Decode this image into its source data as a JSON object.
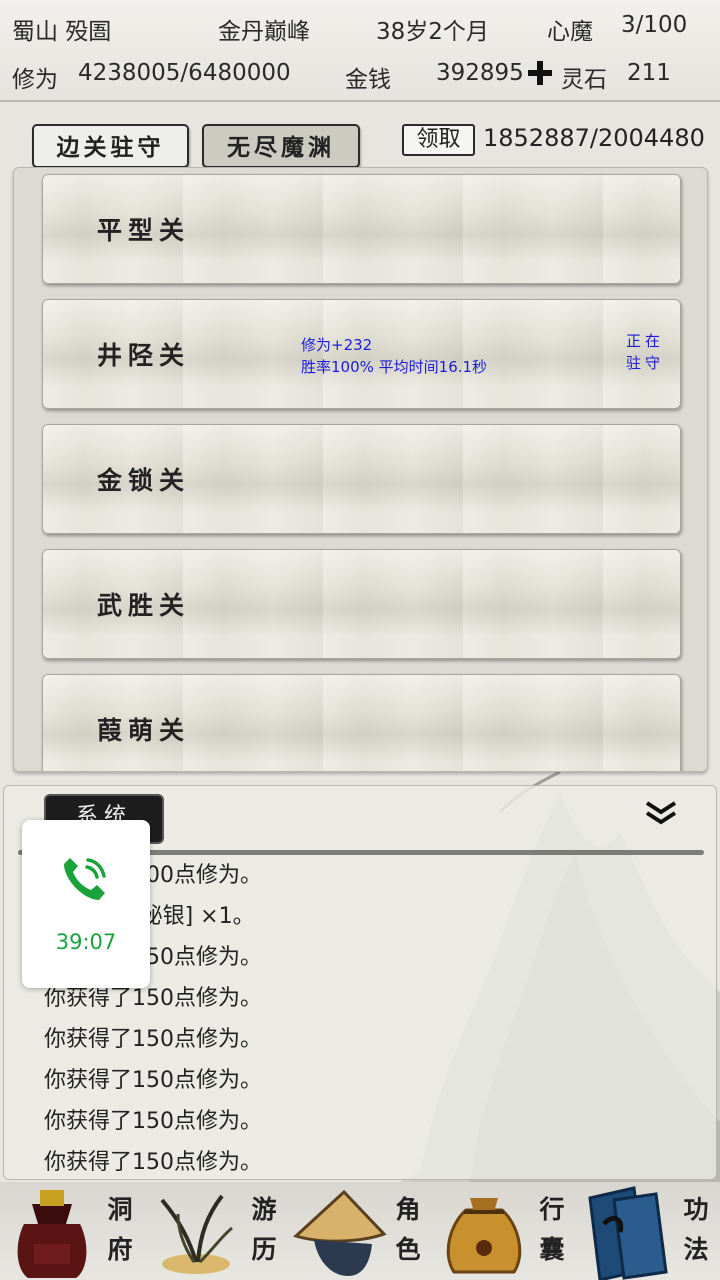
{
  "status": {
    "location": "蜀山 殁圄",
    "realm": "金丹巅峰",
    "age": "38岁2个月",
    "demon_label": "心魔",
    "demon_value": "3/100",
    "cultivation_label": "修为",
    "cultivation_value": "4238005/6480000",
    "money_label": "金钱",
    "money_value": "392895",
    "spirit_label": "灵石",
    "spirit_value": "211"
  },
  "tabs": [
    {
      "label": "边关驻守"
    },
    {
      "label": "无尽魔渊"
    }
  ],
  "claim": {
    "button_label": "领取",
    "progress": "1852887/2004480"
  },
  "passes": [
    {
      "name": "平型关"
    },
    {
      "name": "井陉关",
      "stat1": "修为+232",
      "stat2": "胜率100% 平均时间16.1秒",
      "status": "正在驻守"
    },
    {
      "name": "金锁关"
    },
    {
      "name": "武胜关"
    },
    {
      "name": "葭萌关"
    }
  ],
  "log": {
    "tab_label": "系统",
    "lines": [
      "你获得了300点修为。",
      "你获得了[秘银] ×1。",
      "你获得了150点修为。",
      "你获得了150点修为。",
      "你获得了150点修为。",
      "你获得了150点修为。",
      "你获得了150点修为。",
      "你获得了150点修为。"
    ]
  },
  "call": {
    "timer": "39:07",
    "color": "#1aa33a"
  },
  "nav": [
    {
      "label": "洞府",
      "icon": "treasure-bag-icon"
    },
    {
      "label": "游历",
      "icon": "herb-icon"
    },
    {
      "label": "角色",
      "icon": "straw-hat-icon"
    },
    {
      "label": "行囊",
      "icon": "pouch-icon"
    },
    {
      "label": "功法",
      "icon": "scroll-books-icon"
    }
  ]
}
